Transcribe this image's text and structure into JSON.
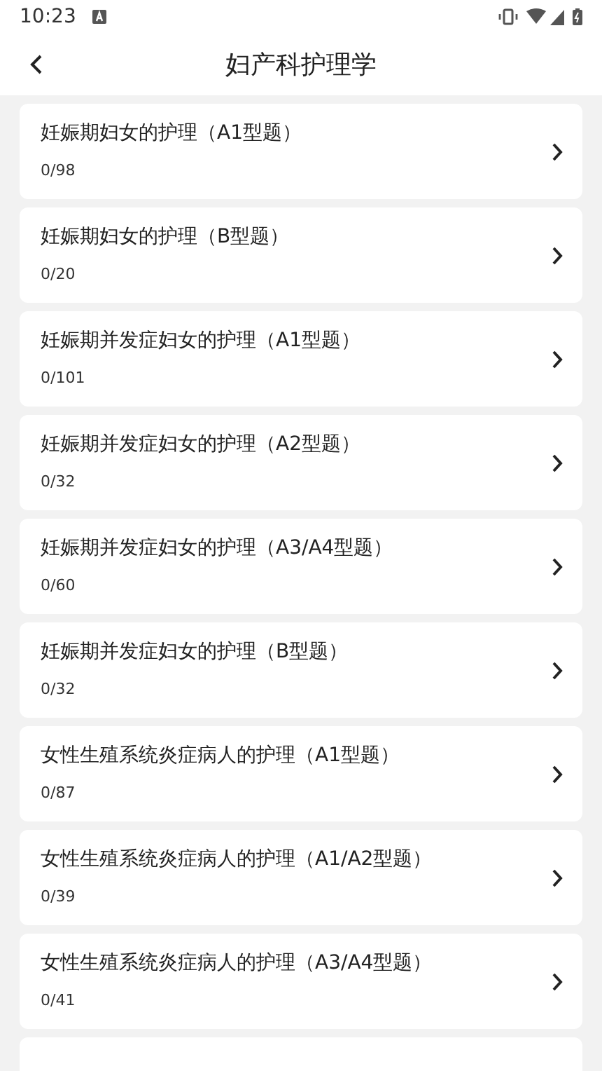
{
  "status_bar": {
    "time": "10:23"
  },
  "header": {
    "title": "妇产科护理学"
  },
  "items": [
    {
      "title": "妊娠期妇女的护理（A1型题）",
      "progress": "0/98"
    },
    {
      "title": "妊娠期妇女的护理（B型题）",
      "progress": "0/20"
    },
    {
      "title": "妊娠期并发症妇女的护理（A1型题）",
      "progress": "0/101"
    },
    {
      "title": "妊娠期并发症妇女的护理（A2型题）",
      "progress": "0/32"
    },
    {
      "title": "妊娠期并发症妇女的护理（A3/A4型题）",
      "progress": "0/60"
    },
    {
      "title": "妊娠期并发症妇女的护理（B型题）",
      "progress": "0/32"
    },
    {
      "title": "女性生殖系统炎症病人的护理（A1型题）",
      "progress": "0/87"
    },
    {
      "title": "女性生殖系统炎症病人的护理（A1/A2型题）",
      "progress": "0/39"
    },
    {
      "title": "女性生殖系统炎症病人的护理（A3/A4型题）",
      "progress": "0/41"
    }
  ],
  "list_continues": true
}
